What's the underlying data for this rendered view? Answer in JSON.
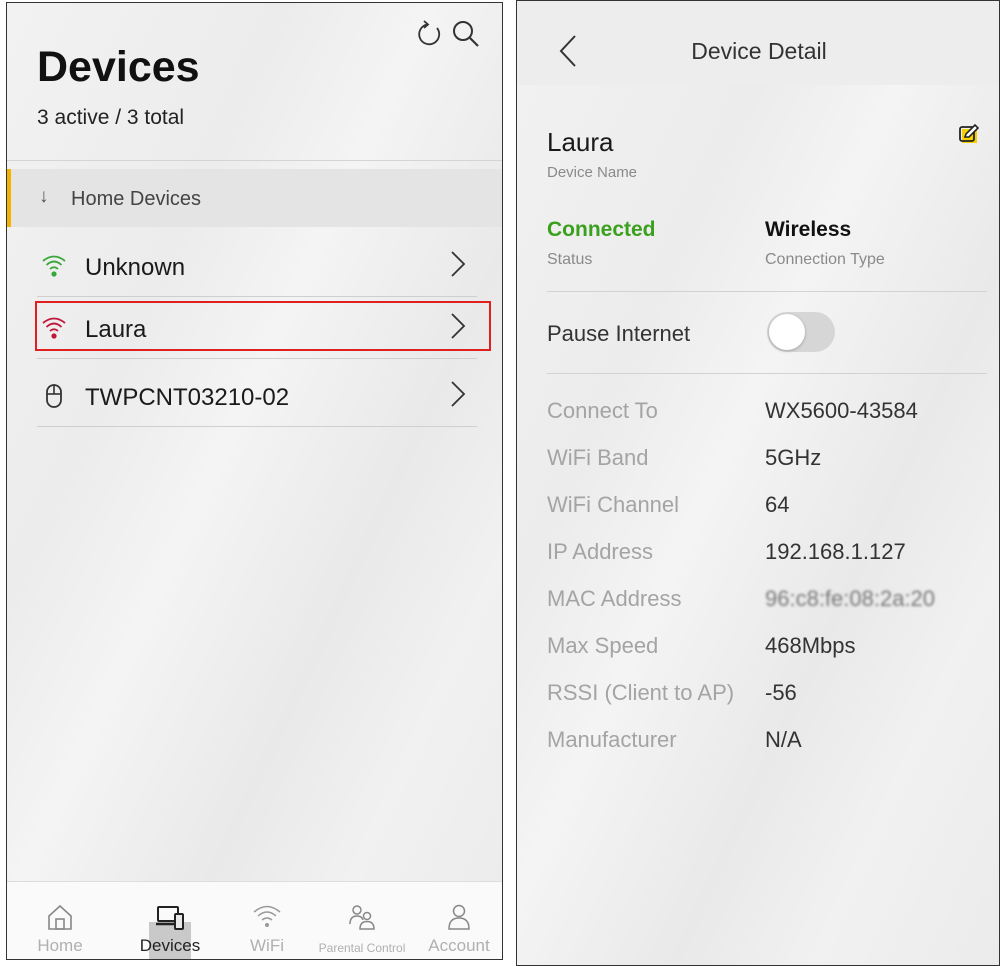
{
  "devices_screen": {
    "title": "Devices",
    "count_text": "3 active / 3 total",
    "group": {
      "arrow": "↓",
      "label": "Home Devices"
    },
    "devices": [
      {
        "name": "Unknown",
        "icon": "wifi-icon",
        "icon_color": "#3aa63a"
      },
      {
        "name": "Laura",
        "icon": "wifi-icon",
        "icon_color": "#c0183a"
      },
      {
        "name": "TWPCNT03210-02",
        "icon": "mouse-icon",
        "icon_color": "#333333"
      }
    ],
    "highlight_color": "#e02020",
    "nav": [
      {
        "label": "Home",
        "icon": "home-icon"
      },
      {
        "label": "Devices",
        "icon": "devices-icon"
      },
      {
        "label": "WiFi",
        "icon": "wifi-icon"
      },
      {
        "label": "Parental Control",
        "icon": "parental-control-icon"
      },
      {
        "label": "Account",
        "icon": "account-icon"
      }
    ],
    "active_nav": "Devices"
  },
  "detail_screen": {
    "title": "Device Detail",
    "device_name": "Laura",
    "device_name_label": "Device Name",
    "status": {
      "value": "Connected",
      "label": "Status",
      "color": "#3aa01e"
    },
    "connection_type": {
      "value": "Wireless",
      "label": "Connection Type"
    },
    "pause_internet": {
      "label": "Pause Internet",
      "enabled": false
    },
    "info": [
      {
        "label": "Connect To",
        "value": "WX5600-43584"
      },
      {
        "label": "WiFi Band",
        "value": "5GHz"
      },
      {
        "label": "WiFi Channel",
        "value": "64"
      },
      {
        "label": "IP Address",
        "value": "192.168.1.127"
      },
      {
        "label": "MAC Address",
        "value": "96:c8:fe:08:2a:20"
      },
      {
        "label": "Max Speed",
        "value": "468Mbps"
      },
      {
        "label": "RSSI (Client to AP)",
        "value": "-56"
      },
      {
        "label": "Manufacturer",
        "value": "N/A"
      }
    ],
    "edit_accent": "#f5d000"
  }
}
